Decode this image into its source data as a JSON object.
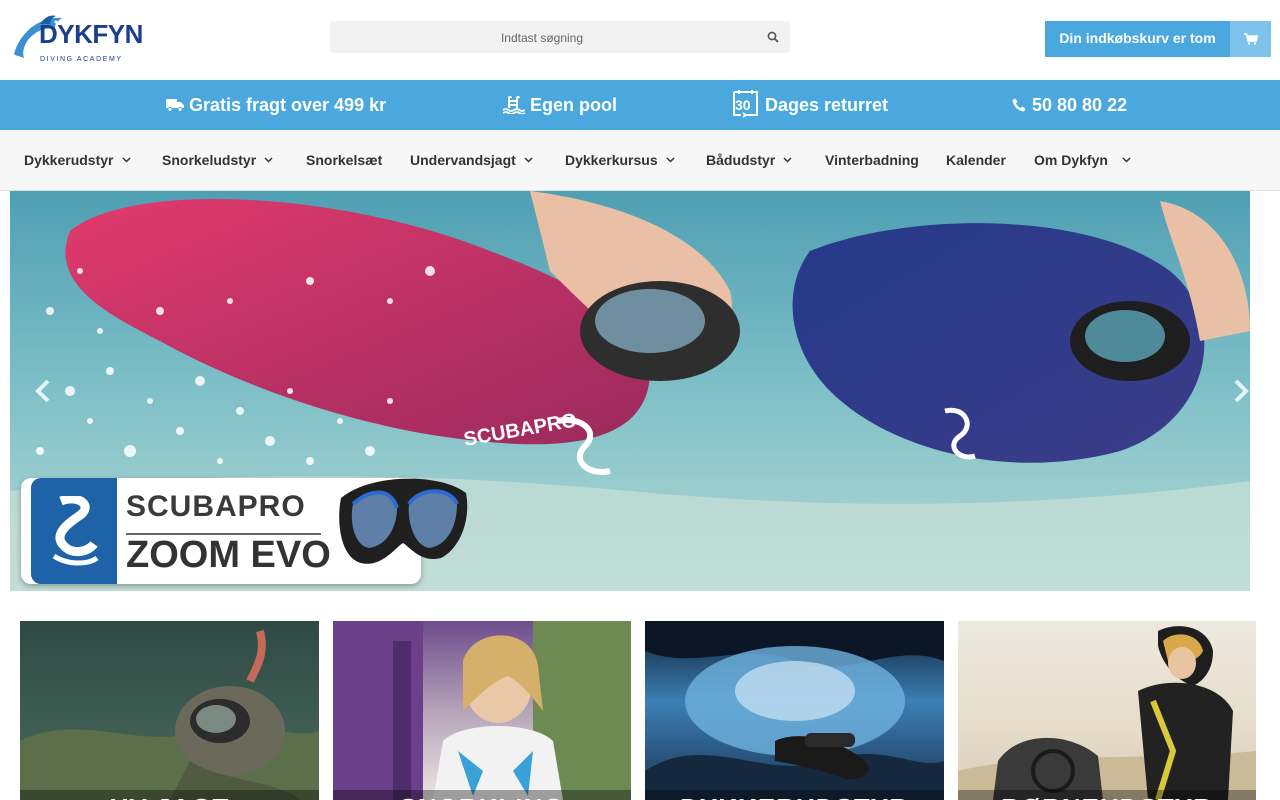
{
  "header": {
    "logo_text": "DYKFYN",
    "logo_subtext": "DIVING ACADEMY",
    "search_placeholder": "Indtast søgning",
    "cart_label": "Din indkøbskurv er tom"
  },
  "usp": {
    "shipping": "Gratis fragt over 499 kr",
    "pool": "Egen pool",
    "return_days": "30",
    "returns": "Dages returret",
    "phone": "50 80 80 22"
  },
  "nav": {
    "items": [
      {
        "label": "Dykkerudstyr",
        "dropdown": true
      },
      {
        "label": "Snorkeludstyr",
        "dropdown": true
      },
      {
        "label": "Snorkelsæt",
        "dropdown": false
      },
      {
        "label": "Undervandsjagt",
        "dropdown": true
      },
      {
        "label": "Dykkerkursus",
        "dropdown": true
      },
      {
        "label": "Bådudstyr",
        "dropdown": true
      },
      {
        "label": "Vinterbadning",
        "dropdown": false
      },
      {
        "label": "Kalender",
        "dropdown": false
      },
      {
        "label": "Om Dykfyn",
        "dropdown": true
      }
    ]
  },
  "hero": {
    "promo_brand": "SCUBAPRO",
    "promo_model": "ZOOM EVO",
    "wetsuit_brand": "SCUBAPRO"
  },
  "categories": [
    {
      "label": "UV-JAGT"
    },
    {
      "label": "SNORKLING"
    },
    {
      "label": "DYKKERUDSTYR"
    },
    {
      "label": "BØRNEUDSTYR"
    }
  ],
  "colors": {
    "accent": "#4aa8df",
    "brand_dark": "#1b3f8b",
    "nav_bg": "#f7f7f7"
  },
  "icons": {
    "search": "search-icon",
    "cart": "cart-icon",
    "truck": "truck-icon",
    "pool": "pool-icon",
    "calendar": "calendar-return-icon",
    "phone": "phone-icon"
  }
}
